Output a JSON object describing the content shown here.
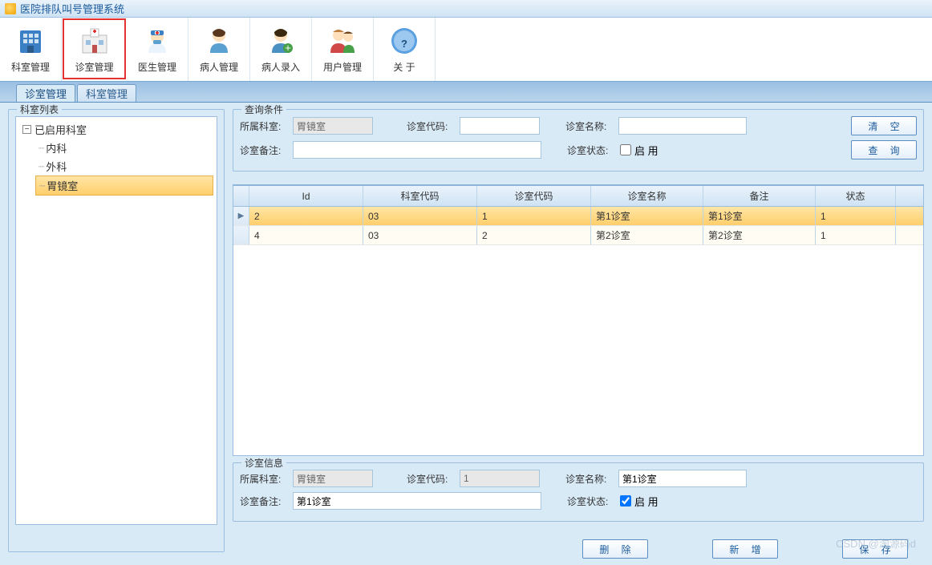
{
  "window_title": "医院排队叫号管理系统",
  "toolbar": [
    {
      "label": "科室管理",
      "name": "dept-mgmt"
    },
    {
      "label": "诊室管理",
      "name": "room-mgmt",
      "selected": true
    },
    {
      "label": "医生管理",
      "name": "doctor-mgmt"
    },
    {
      "label": "病人管理",
      "name": "patient-mgmt"
    },
    {
      "label": "病人录入",
      "name": "patient-entry"
    },
    {
      "label": "用户管理",
      "name": "user-mgmt"
    },
    {
      "label": "关 于",
      "name": "about"
    }
  ],
  "tabs": [
    {
      "label": "诊室管理",
      "active": true
    },
    {
      "label": "科室管理",
      "active": false
    }
  ],
  "tree": {
    "legend": "科室列表",
    "root": "已启用科室",
    "children": [
      {
        "label": "内科"
      },
      {
        "label": "外科"
      },
      {
        "label": "胃镜室",
        "selected": true
      }
    ]
  },
  "query": {
    "legend": "查询条件",
    "dept_label": "所属科室:",
    "dept_value": "胃镜室",
    "code_label": "诊室代码:",
    "code_value": "",
    "name_label": "诊室名称:",
    "name_value": "",
    "remark_label": "诊室备注:",
    "remark_value": "",
    "state_label": "诊室状态:",
    "state_check": "启 用",
    "state_checked": false,
    "clear_btn": "清 空",
    "query_btn": "查 询"
  },
  "grid": {
    "headers": [
      "Id",
      "科室代码",
      "诊室代码",
      "诊室名称",
      "备注",
      "状态"
    ],
    "rows": [
      {
        "id": "2",
        "dept_code": "03",
        "room_code": "1",
        "room_name": "第1诊室",
        "remark": "第1诊室",
        "state": "1",
        "selected": true
      },
      {
        "id": "4",
        "dept_code": "03",
        "room_code": "2",
        "room_name": "第2诊室",
        "remark": "第2诊室",
        "state": "1",
        "selected": false
      }
    ]
  },
  "detail": {
    "legend": "诊室信息",
    "dept_label": "所属科室:",
    "dept_value": "胃镜室",
    "code_label": "诊室代码:",
    "code_value": "1",
    "name_label": "诊室名称:",
    "name_value": "第1诊室",
    "remark_label": "诊室备注:",
    "remark_value": "第1诊室",
    "state_label": "诊室状态:",
    "state_check": "启 用",
    "state_checked": true
  },
  "footer": {
    "delete": "删 除",
    "add": "新 增",
    "save": "保 存"
  },
  "watermark": "CSDN @淘源码d"
}
